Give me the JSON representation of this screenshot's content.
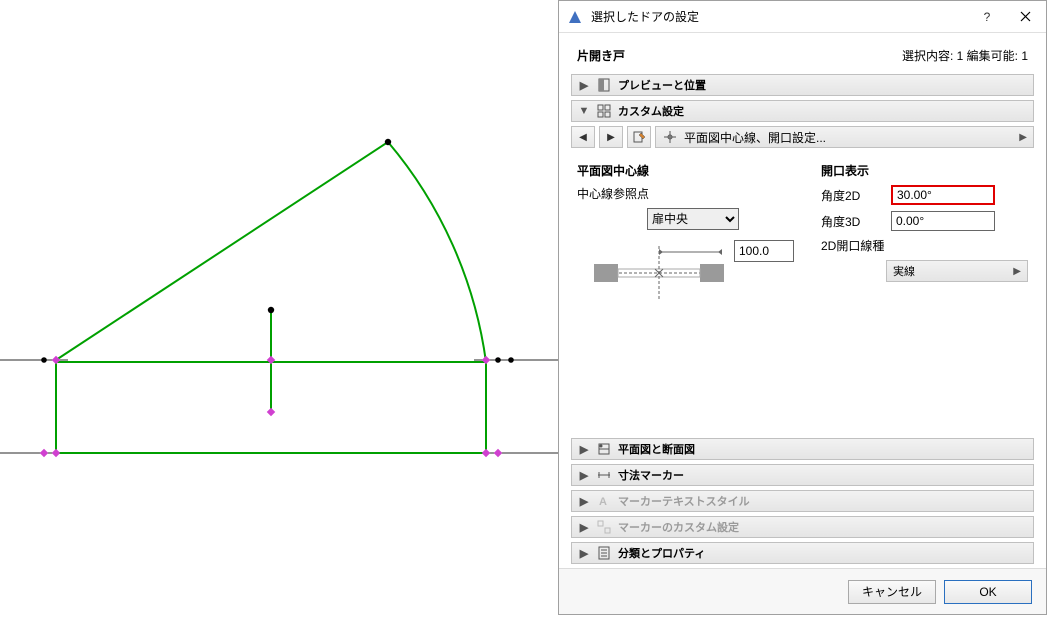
{
  "dialog": {
    "title": "選択したドアの設定",
    "header_label": "片開き戸",
    "header_status": "選択内容: 1 編集可能: 1"
  },
  "sections": {
    "preview": "プレビューと位置",
    "custom": "カスタム設定",
    "plan_section": "平面図と断面図",
    "dim_marker": "寸法マーカー",
    "marker_text_style": "マーカーテキストスタイル",
    "marker_custom": "マーカーのカスタム設定",
    "classify": "分類とプロパティ"
  },
  "breadcrumb": {
    "label": "平面図中心線、開口設定..."
  },
  "custom": {
    "left_title": "平面図中心線",
    "ref_label": "中心線参照点",
    "select_value": "扉中央",
    "offset_value": "100.0",
    "right_title": "開口表示",
    "angle2d_label": "角度2D",
    "angle2d_value": "30.00°",
    "angle3d_label": "角度3D",
    "angle3d_value": "0.00°",
    "linetype_label": "2D開口線種",
    "linetype_value": "実線"
  },
  "footer": {
    "cancel": "キャンセル",
    "ok": "OK"
  }
}
